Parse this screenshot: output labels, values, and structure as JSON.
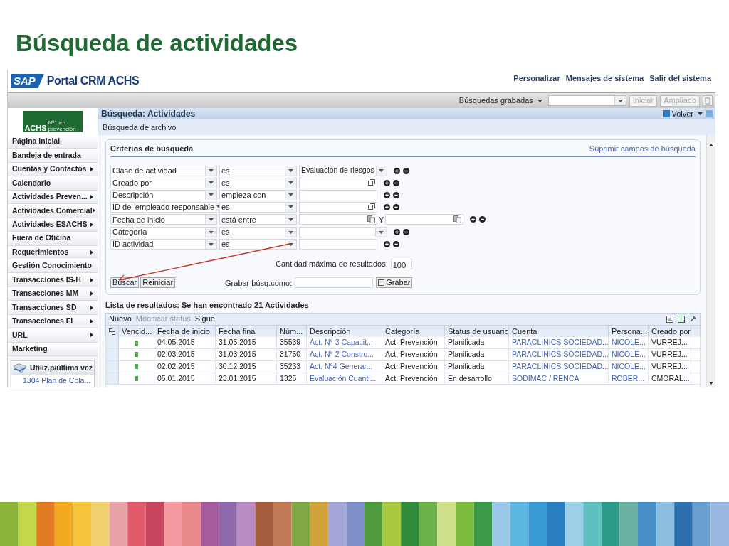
{
  "slide_title": "Búsqueda de actividades",
  "portal": {
    "logo": "SAP",
    "title": "Portal CRM ACHS",
    "header_links": [
      "Personalizar",
      "Mensajes de sistema",
      "Salir del sistema"
    ]
  },
  "toolbar": {
    "saved_searches": "Búsquedas grabadas",
    "buttons": [
      "Iniciar",
      "Ampliado"
    ]
  },
  "sidebar": {
    "logo": "ACHS",
    "logo_caption": "Nº1 en prevención",
    "items": [
      {
        "label": "Página inicial",
        "has_submenu": false
      },
      {
        "label": "Bandeja de entrada",
        "has_submenu": false
      },
      {
        "label": "Cuentas y Contactos",
        "has_submenu": true
      },
      {
        "label": "Calendario",
        "has_submenu": false
      },
      {
        "label": "Actividades Preven...",
        "has_submenu": true
      },
      {
        "label": "Actividades Comercial",
        "has_submenu": true
      },
      {
        "label": "Actividades ESACHS",
        "has_submenu": true
      },
      {
        "label": "Fuera de Oficina",
        "has_submenu": false
      },
      {
        "label": "Requerimientos",
        "has_submenu": true
      },
      {
        "label": "Gestión Conocimiento",
        "has_submenu": false
      },
      {
        "label": "Transacciones IS-H",
        "has_submenu": true
      },
      {
        "label": "Transacciones MM",
        "has_submenu": true
      },
      {
        "label": "Transacciones SD",
        "has_submenu": true
      },
      {
        "label": "Transacciones FI",
        "has_submenu": true
      },
      {
        "label": "URL",
        "has_submenu": true
      },
      {
        "label": "Marketing",
        "has_submenu": false
      }
    ],
    "recent_title": "Utiliz.p/última vez",
    "recent_items": [
      "1304 Plan de Cola..."
    ]
  },
  "page": {
    "title": "Búsqueda: Actividades",
    "back": "Volver",
    "subtitle": "Búsqueda de archivo"
  },
  "criteria": {
    "title": "Criterios de búsqueda",
    "clear_link": "Suprimir campos de búsqueda",
    "rows": [
      {
        "field": "Clase de actividad",
        "operator": "es",
        "value": "Evaluación de riesgos",
        "kind": "dropdown"
      },
      {
        "field": "Creado por",
        "operator": "es",
        "kind": "help"
      },
      {
        "field": "Descripción",
        "operator": "empieza con",
        "kind": "text"
      },
      {
        "field": "ID del empleado responsable",
        "operator": "es",
        "kind": "help"
      },
      {
        "field": "Fecha de inicio",
        "operator": "está entre",
        "kind": "date_range",
        "range_word": "Y"
      },
      {
        "field": "Categoría",
        "operator": "es",
        "kind": "dropdown"
      },
      {
        "field": "ID actividad",
        "operator": "es",
        "kind": "text"
      }
    ],
    "max_label": "Cantidad máxima de resultados:",
    "max_value": "100",
    "search_button": "Buscar",
    "reset_button": "Reiniciar",
    "save_label": "Grabar búsq.como:",
    "save_button": "Grabar"
  },
  "results": {
    "title": "Lista de resultados: Se han encontrado 21 Actividades",
    "toolbar": [
      {
        "label": "Nuevo",
        "disabled": false
      },
      {
        "label": "Modificar status",
        "disabled": true
      },
      {
        "label": "Sigue",
        "disabled": false
      }
    ],
    "columns": [
      {
        "label": "Vencid...",
        "kind": "status"
      },
      {
        "label": "Fecha de inicio",
        "kind": "text"
      },
      {
        "label": "Fecha final",
        "kind": "text"
      },
      {
        "label": "Núm...",
        "kind": "text"
      },
      {
        "label": "Descripción",
        "kind": "link"
      },
      {
        "label": "Categoría",
        "kind": "text"
      },
      {
        "label": "Status de usuario",
        "kind": "text"
      },
      {
        "label": "Cuenta",
        "kind": "link"
      },
      {
        "label": "Persona...",
        "kind": "link"
      },
      {
        "label": "Creado por",
        "kind": "text"
      }
    ],
    "rows": [
      {
        "color": "#3cb44a",
        "cells": [
          "",
          "04.05.2015",
          "31.05.2015",
          "35539",
          "Act. N° 3 Capacit...",
          "Act. Prevención",
          "Planificada",
          "PARACLINICS SOCIEDAD...",
          "NICOLE...",
          "VURREJ..."
        ]
      },
      {
        "color": "#3cb44a",
        "cells": [
          "",
          "02.03.2015",
          "31.03.2015",
          "31750",
          "Act. N° 2 Constru...",
          "Act. Prevención",
          "Planificada",
          "PARACLINICS SOCIEDAD...",
          "NICOLE...",
          "VURREJ..."
        ]
      },
      {
        "color": "#3cb44a",
        "cells": [
          "",
          "02.02.2015",
          "30.12.2015",
          "35233",
          "Act. N°4 Generar...",
          "Act. Prevención",
          "Planificada",
          "PARACLINICS SOCIEDAD...",
          "NICOLE...",
          "VURREJ..."
        ]
      },
      {
        "color": "#3cb44a",
        "cells": [
          "",
          "05.01.2015",
          "23.01.2015",
          "1325",
          "Evaluación Cuanti...",
          "Act. Prevención",
          "En desarrollo",
          "SODIMAC / RENCA",
          "ROBER...",
          "CMORAL..."
        ]
      }
    ]
  }
}
